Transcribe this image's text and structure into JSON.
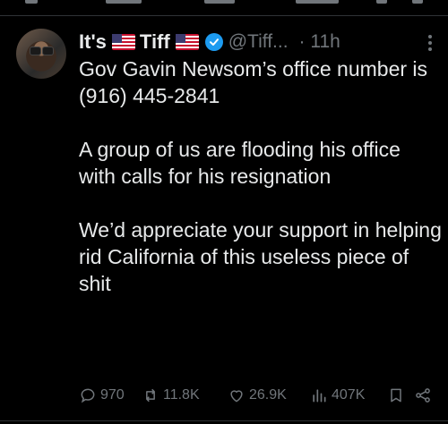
{
  "tweet": {
    "author": {
      "display_name_prefix": "It's",
      "display_name_main": "Tiff",
      "handle": "@Tiff...",
      "time": "· 11h",
      "verified": true
    },
    "paragraphs": [
      "Gov Gavin Newsom’s office number is (916) 445-2841",
      "A group of us are flooding his office with calls for his resignation",
      "We’d appreciate your support in helping rid California of this useless piece of shit"
    ],
    "actions": {
      "replies": "970",
      "retweets": "11.8K",
      "likes": "26.9K",
      "views": "407K"
    }
  },
  "colors": {
    "background": "#000000",
    "text": "#e7e9ea",
    "muted": "#71767b",
    "verified": "#1d9bf0"
  }
}
